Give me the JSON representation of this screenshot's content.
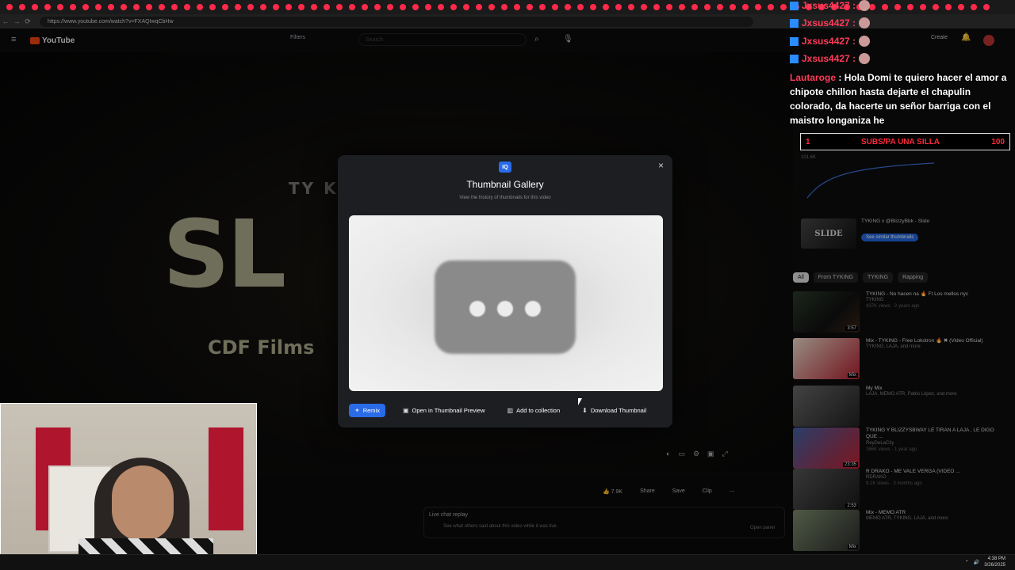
{
  "browser": {
    "url": "https://www.youtube.com/watch?v=FXAQIwqCbHw"
  },
  "youtube": {
    "logo_text": "YouTube",
    "filters_label": "Filters",
    "search_placeholder": "Search",
    "create_label": "Create"
  },
  "video": {
    "title_fragment_top": "TY K",
    "big_title": "SL",
    "subtitle": "CDF Films"
  },
  "modal": {
    "logo": "IQ",
    "title": "Thumbnail Gallery",
    "subtitle": "View the history of thumbnails for this video",
    "close_label": "×",
    "buttons": {
      "remix": "Remix",
      "open_preview": "Open in Thumbnail Preview",
      "add_collection": "Add to collection",
      "download": "Download Thumbnail"
    }
  },
  "chat": {
    "lines": [
      {
        "user": "Jxsus4427 :"
      },
      {
        "user": "Jxsus4427 :"
      },
      {
        "user": "Jxsus4427 :"
      }
    ],
    "message_user": "Lautaroge",
    "message_text": ": Hola Domi te quiero hacer el amor a chipote chillon hasta dejarte el chapulin colorado, da hacerte un señor barriga con el maistro longaniza he"
  },
  "goal": {
    "current": "1",
    "label": "SUBS/PA UNA SILLA",
    "target": "100"
  },
  "sidebar": {
    "stats_value": "101.6K",
    "video_card": {
      "thumb_text": "SLIDE",
      "title": "TYKING x @BlizzyBbk - Slide",
      "button": "See similar thumbnails"
    },
    "chips": [
      "All",
      "From TYKING",
      "TYKING",
      "Rapping"
    ],
    "recommendations": [
      {
        "title": "TYKING - No hacen na 🔥 Ft Los mellos nyc",
        "channel": "TYKING",
        "stats": "437K views · 2 years ago",
        "duration": "3:57"
      },
      {
        "title": "Mix - TYKING - Free Lokotron 🔥 ✖ (Video Official)",
        "channel": "TYKING, LAJA, and more",
        "stats": "",
        "duration": "Mix"
      },
      {
        "title": "My Mix",
        "channel": "LAJA, MEMO ATR, Pablo López, and more",
        "stats": "",
        "duration": ""
      },
      {
        "title": "TYKING Y BLIZZYSBWAY LE TIRAN A LAJA , LE DIGO QUE ...",
        "channel": "ReyDeLaCity",
        "stats": "166K views · 1 year ago",
        "duration": "23:35"
      },
      {
        "title": "R DRAKO - ME VALE VERGA (VIDEO ...",
        "channel": "RDRAKO",
        "stats": "9.1K views · 3 months ago",
        "duration": "2:53"
      },
      {
        "title": "Mix - MEMO ATR",
        "channel": "MEMO ATR, TYKING, LAJA, and more",
        "stats": "",
        "duration": "Mix"
      }
    ]
  },
  "below_video": {
    "likes": "7.9K",
    "share": "Share",
    "save": "Save",
    "clip": "Clip",
    "live_chat_title": "Live chat replay",
    "live_chat_sub": "See what others said about this video while it was live.",
    "open_panel": "Open panel"
  },
  "taskbar": {
    "time": "4:38 PM",
    "date": "3/26/2025"
  },
  "colors": {
    "accent": "#2a6be8",
    "chat_name": "#ff3c5a",
    "goal_text": "#ff2a3a"
  }
}
